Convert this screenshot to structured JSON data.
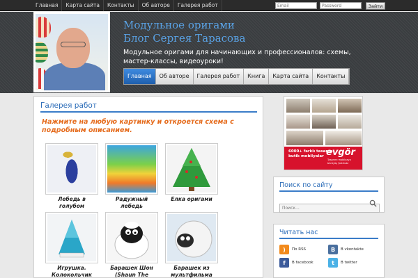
{
  "topnav": [
    "Главная",
    "Карта сайта",
    "Контакты",
    "Об авторе",
    "Галерея работ"
  ],
  "login": {
    "email_placeholder": "Email",
    "password_placeholder": "Password",
    "button_label": "Зайти"
  },
  "header": {
    "title_line1": "Модульное оригами",
    "title_line2": "Блог Сергея Тарасова",
    "description": "Модульное оригами для начинающих и профессионалов: схемы, мастер-классы, видеоуроки!"
  },
  "mainnav": [
    "Главная",
    "Об авторе",
    "Галерея работ",
    "Книга",
    "Карта сайта",
    "Контакты"
  ],
  "content": {
    "heading": "Галерея работ",
    "intro": "Нажмите на любую картинку и откроется схема с подробным описанием.",
    "gallery": [
      "Лебедь в голубом",
      "Радужный лебедь",
      "Елка оригами",
      "Игрушка. Колокольчик",
      "Барашек Шон (Shaun The Sheep)",
      "Барашек из мультфильма"
    ]
  },
  "ad": {
    "line1": "6000+ farklı tasarım",
    "line2": "butik mobilyalar",
    "brand": "evgör",
    "slogan": "Tasarımı mobilyaya bürüyüş Şeklinde"
  },
  "sidebar": {
    "search_title": "Поиск по сайту",
    "search_placeholder": "Поиск...",
    "follow_title": "Читать нас",
    "links": [
      "По RSS",
      "В vkontakte",
      "В facebook",
      "В twitter"
    ]
  },
  "colors": {
    "accent": "#2b6cb8",
    "intro_orange": "#e56b1c",
    "nav_active": "#2d75c8",
    "topbar": "#2b2b2b"
  }
}
